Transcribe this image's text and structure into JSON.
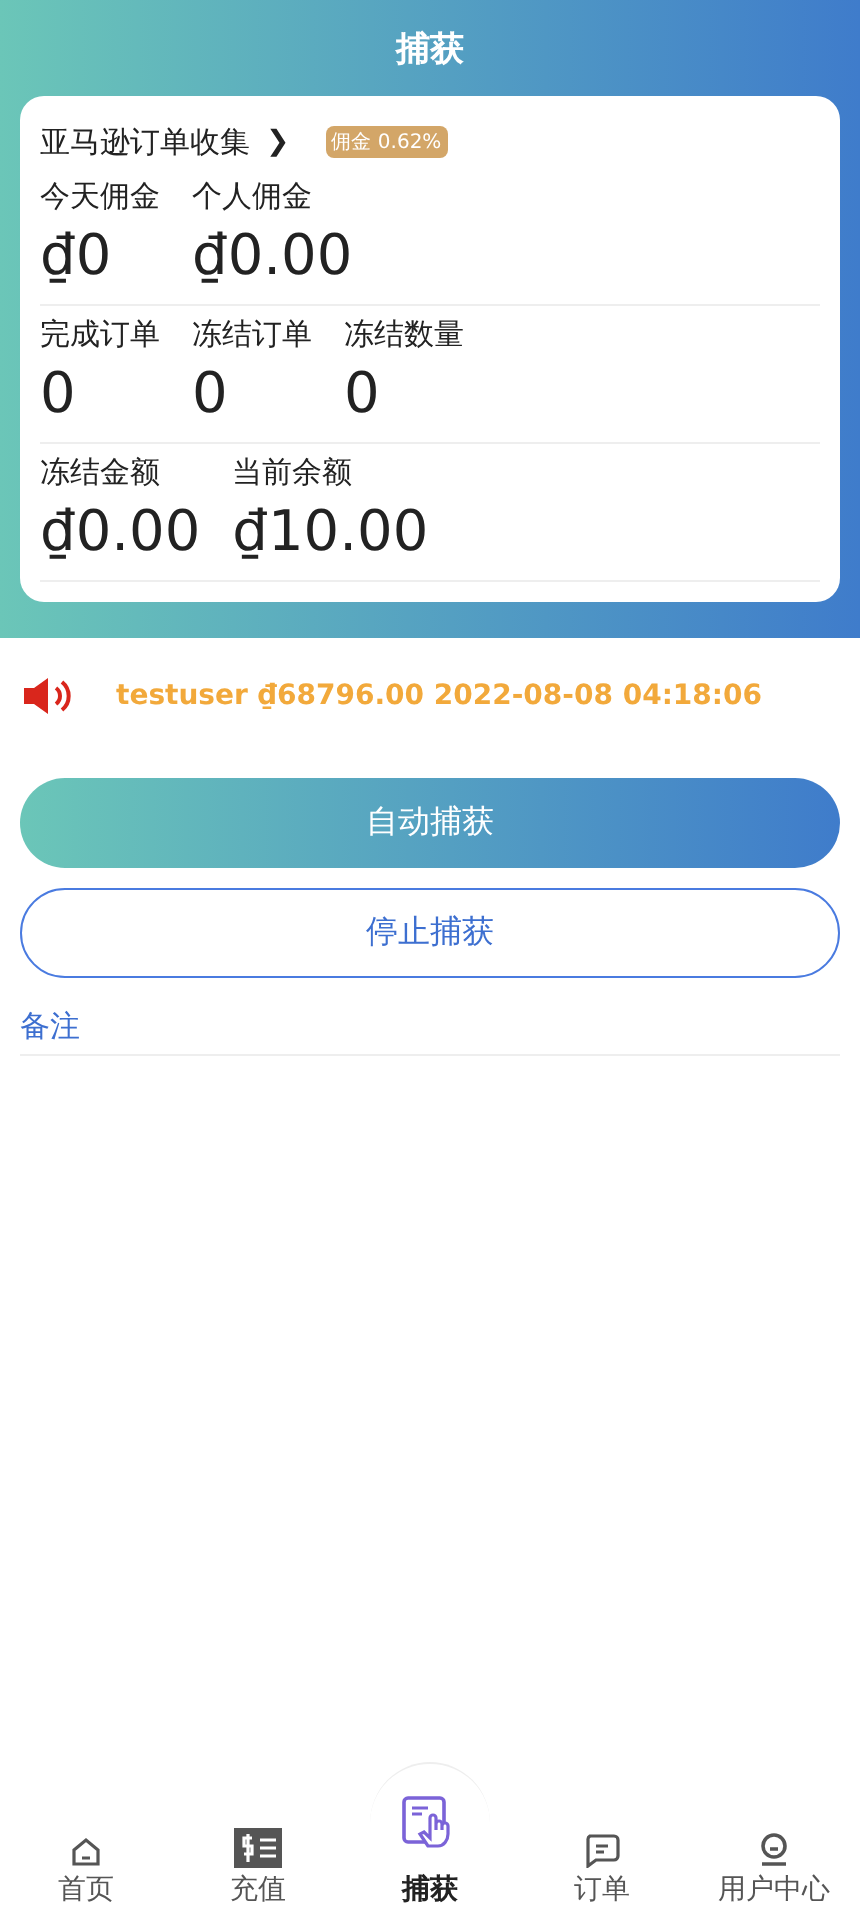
{
  "header": {
    "title": "捕获"
  },
  "card": {
    "title": "亚马逊订单收集",
    "chevron": "❯",
    "badge": "佣金 0.62%",
    "rows": [
      [
        {
          "label": "今天佣金",
          "value": "₫0"
        },
        {
          "label": "个人佣金",
          "value": "₫0.00"
        }
      ],
      [
        {
          "label": "完成订单",
          "value": "0"
        },
        {
          "label": "冻结订单",
          "value": "0"
        },
        {
          "label": "冻结数量",
          "value": "0"
        }
      ],
      [
        {
          "label": "冻结金额",
          "value": "₫0.00"
        },
        {
          "label": "当前余额",
          "value": "₫10.00"
        }
      ]
    ]
  },
  "notice": {
    "text": "testuser ₫68796.00 2022-08-08 04:18:06"
  },
  "buttons": [
    {
      "label": "自动捕获",
      "kind": "filled"
    },
    {
      "label": "停止捕获",
      "kind": "outline"
    }
  ],
  "remark": {
    "label": "备注"
  },
  "nav": [
    {
      "label": "首页",
      "selected": false
    },
    {
      "label": "充值",
      "selected": false
    },
    {
      "label": "捕获",
      "selected": true
    },
    {
      "label": "订单",
      "selected": false
    },
    {
      "label": "用户中心",
      "selected": false
    }
  ]
}
